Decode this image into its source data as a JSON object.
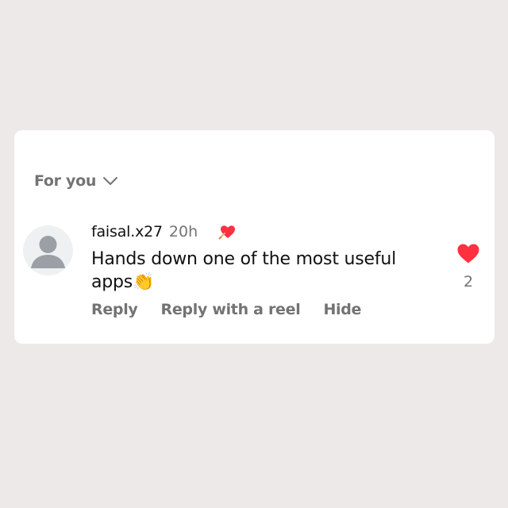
{
  "sort": {
    "label": "For you",
    "icon": "chevron-down-icon"
  },
  "comment": {
    "username": "faisal.x27",
    "timestamp": "20h",
    "creator_badge_icon": "creator-liked-heart-icon",
    "text": "Hands down one of the most useful apps👏",
    "actions": {
      "reply": "Reply",
      "reply_with_reel": "Reply with a reel",
      "hide": "Hide"
    },
    "like": {
      "icon": "heart-filled-icon",
      "count": "2",
      "liked": true
    }
  },
  "colors": {
    "background": "#ede9e8",
    "card": "#ffffff",
    "text_primary": "#111111",
    "text_secondary": "#737373",
    "like_red": "#ff3040",
    "avatar_bg": "#eff0f2",
    "avatar_fg": "#9aa0a6"
  }
}
